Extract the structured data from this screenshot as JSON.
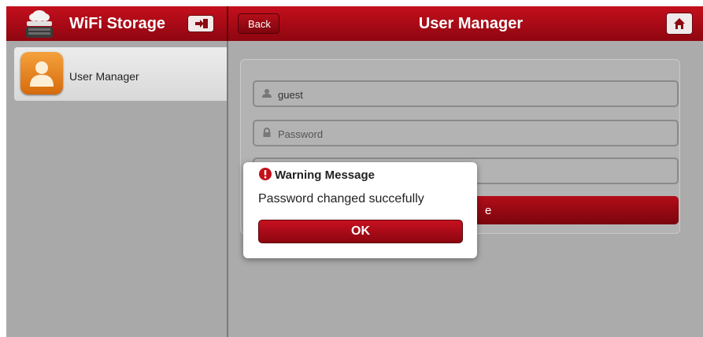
{
  "header": {
    "app_title": "WiFi Storage",
    "back_label": "Back",
    "page_title": "User Manager",
    "accent_color": "#c40f1d"
  },
  "sidebar": {
    "items": [
      {
        "label": "User Manager",
        "icon": "user-manager-icon"
      }
    ]
  },
  "form": {
    "username_value": "guest",
    "password_placeholder": "Password",
    "save_label_visible": "e"
  },
  "dialog": {
    "title": "Warning Message",
    "message": "Password changed succefully",
    "ok_label": "OK"
  }
}
